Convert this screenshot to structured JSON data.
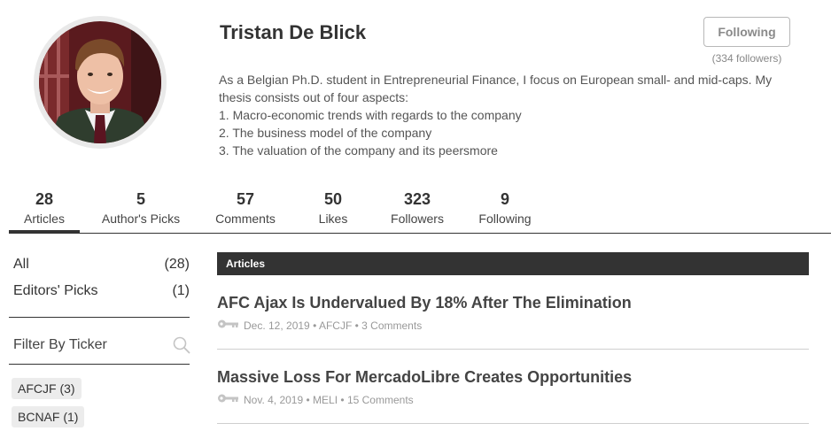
{
  "profile": {
    "name": "Tristan De Blick",
    "bio_lines": [
      "As a Belgian Ph.D. student in Entrepreneurial Finance, I focus on European small- and mid-caps. My",
      "thesis consists out of four aspects:",
      "1. Macro-economic trends with regards to the company",
      "2. The business model of the company",
      "3. The valuation of the company and its peersmore"
    ],
    "follow_button_label": "Following",
    "follower_count_text": "(334 followers)",
    "avatar_icon": "profile-photo"
  },
  "stats": [
    {
      "value": "28",
      "label": "Articles",
      "active": true
    },
    {
      "value": "5",
      "label": "Author's Picks",
      "active": false
    },
    {
      "value": "57",
      "label": "Comments",
      "active": false
    },
    {
      "value": "50",
      "label": "Likes",
      "active": false
    },
    {
      "value": "323",
      "label": "Followers",
      "active": false
    },
    {
      "value": "9",
      "label": "Following",
      "active": false
    }
  ],
  "sidebar": {
    "filters": [
      {
        "label": "All",
        "count": "(28)"
      },
      {
        "label": "Editors' Picks",
        "count": "(1)"
      }
    ],
    "filter_by_ticker_label": "Filter By Ticker",
    "search_icon": "search-icon",
    "tickers": [
      {
        "label": "AFCJF (3)"
      },
      {
        "label": "BCNAF (1)"
      }
    ]
  },
  "articles": {
    "header": "Articles",
    "items": [
      {
        "title": "AFC Ajax Is Undervalued By 18% After The Elimination",
        "date": "Dec. 12, 2019",
        "ticker": "AFCJF",
        "comments": "3 Comments",
        "separator": "•",
        "icon": "key-icon"
      },
      {
        "title": "Massive Loss For MercadoLibre Creates Opportunities",
        "date": "Nov. 4, 2019",
        "ticker": "MELI",
        "comments": "15 Comments",
        "separator": "•",
        "icon": "key-icon"
      }
    ]
  },
  "colors": {
    "text_dark": "#333333",
    "header_bg": "#333333",
    "chip_bg": "#ececec",
    "meta_gray": "#999999"
  }
}
